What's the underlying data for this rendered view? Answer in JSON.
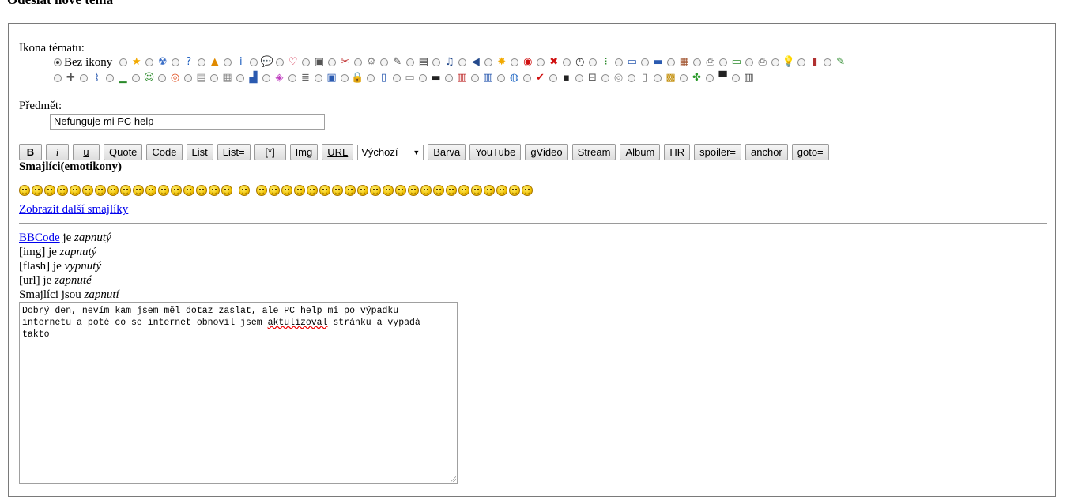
{
  "page": {
    "heading": "Odeslat nové téma"
  },
  "topic_icon": {
    "label": "Ikona tématu:",
    "none_label": "Bez ikony",
    "row1": [
      "star-icon",
      "radiation-icon",
      "help-icon",
      "warning-icon",
      "info-icon",
      "speech-bubble-icon",
      "heart-icon",
      "windows-icon",
      "tools-icon",
      "gear-icon",
      "pen-icon",
      "camera-icon",
      "music-icon",
      "back-icon",
      "burst-icon",
      "stop-icon",
      "close-icon",
      "clock-icon",
      "traffic-light-icon",
      "monitor-icon",
      "laptop-icon",
      "calculator-icon",
      "printer-icon",
      "card-icon",
      "printer-icon",
      "bulb-icon",
      "battery-icon",
      "edit-icon"
    ],
    "row2": [
      "gamepad-icon",
      "antenna-icon",
      "signal-icon",
      "smile-icon",
      "lifebuoy-icon",
      "table-icon",
      "grid-icon",
      "blocks-icon",
      "palette-icon",
      "database-icon",
      "window-icon",
      "lock-icon",
      "phone-icon",
      "keyboard-icon",
      "screen-icon",
      "book-icon",
      "chart-icon",
      "globe-icon",
      "pdf-icon",
      "floppy-icon",
      "scanner-icon",
      "disc-icon",
      "usb-icon",
      "package-icon",
      "clover-icon",
      "hat-icon",
      "trash-icon"
    ]
  },
  "subject": {
    "label": "Předmět:",
    "value": "Nefunguje mi PC help"
  },
  "toolbar": {
    "buttons_left": [
      "B",
      "i",
      "u",
      "Quote",
      "Code",
      "List",
      "List=",
      "[*]",
      "Img",
      "URL"
    ],
    "select_value": "Výchozí",
    "buttons_right": [
      "Barva",
      "YouTube",
      "gVideo",
      "Stream",
      "Album",
      "HR",
      "spoiler=",
      "anchor",
      "goto="
    ]
  },
  "smileys": {
    "heading": "Smajlíci(emotikony)",
    "count": 40,
    "more_link": "Zobrazit další smajlíky"
  },
  "status": {
    "bbcode_link": "BBCode",
    "bbcode_text": " je ",
    "bbcode_state": "zapnutý",
    "img_text": "[img] je ",
    "img_state": "zapnutý",
    "flash_text": "[flash] je ",
    "flash_state": "vypnutý",
    "url_text": "[url] je ",
    "url_state": "zapnuté",
    "smileys_text": "Smajlíci jsou ",
    "smileys_state": "zapnutí"
  },
  "message": {
    "line1": "Dobrý den, nevím kam jsem měl dotaz zaslat, ale PC help mi po výpadku",
    "line2a": "internetu a poté co se internet obnovil jsem ",
    "line2_misspelled": "aktulizoval",
    "line2b": " stránku a vypadá",
    "line3": "takto"
  }
}
